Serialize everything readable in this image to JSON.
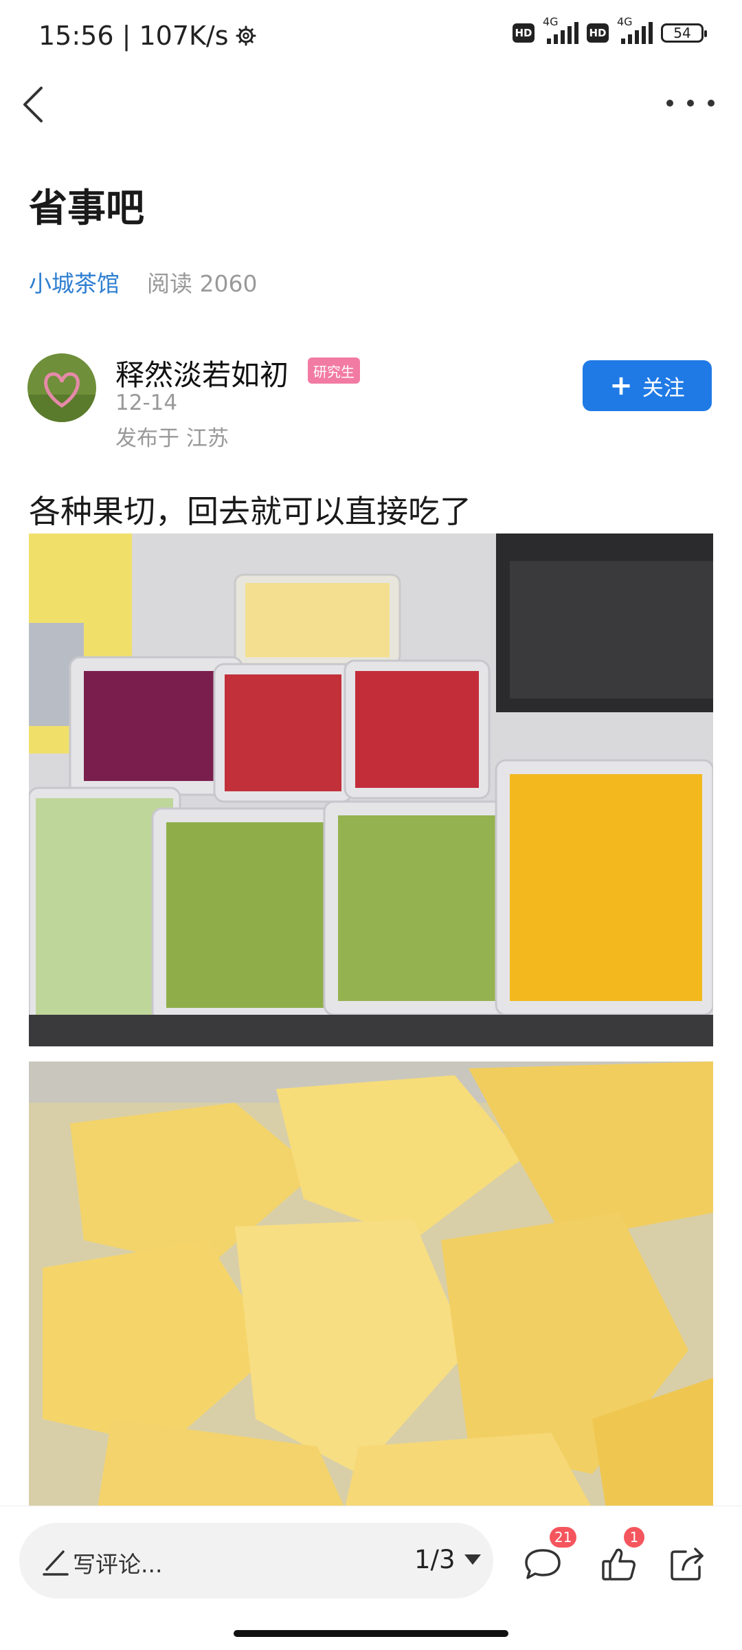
{
  "status_bar": {
    "time_speed": "15:56 | 107K/s",
    "hd_label": "HD",
    "network_label": "4G",
    "battery": "54"
  },
  "post": {
    "title": "省事吧",
    "forum": "小城茶馆",
    "read_count": "阅读 2060",
    "body": "各种果切，回去就可以直接吃了"
  },
  "author": {
    "name": "释然淡若如初",
    "badge": "研究生",
    "date": "12-14",
    "location": "发布于 江苏"
  },
  "follow_button": {
    "plus": "+",
    "label": "关注"
  },
  "bottom_bar": {
    "comment_placeholder": "写评论...",
    "page_indicator": "1/3",
    "comment_count": "21",
    "like_count": "1"
  },
  "colors": {
    "accent": "#1f7ae5",
    "forum_link": "#2f7fd1",
    "badge_pink": "#f27ba3",
    "notification_red": "#f5555d"
  },
  "icons": [
    "back-icon",
    "more-icon",
    "pencil-icon",
    "chevron-down-icon",
    "comment-icon",
    "like-icon",
    "share-icon",
    "settings-icon"
  ]
}
